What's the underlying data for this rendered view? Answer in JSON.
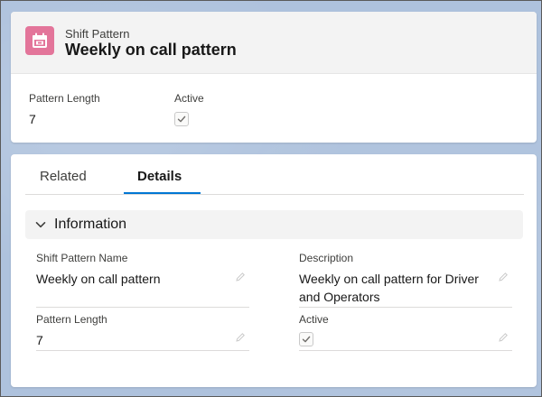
{
  "header": {
    "object_type": "Shift Pattern",
    "record_title": "Weekly on call pattern",
    "icon": "calendar-icon",
    "icon_color": "#e3759a",
    "highlights": [
      {
        "label": "Pattern Length",
        "value": "7"
      },
      {
        "label": "Active",
        "checked": true
      }
    ]
  },
  "tabs": [
    {
      "label": "Related",
      "active": false
    },
    {
      "label": "Details",
      "active": true
    }
  ],
  "accent_color": "#0176d3",
  "section": {
    "title": "Information",
    "expanded": true,
    "fields": {
      "shift_pattern_name": {
        "label": "Shift Pattern Name",
        "value": "Weekly on call pattern"
      },
      "description": {
        "label": "Description",
        "value": "Weekly on call pattern for Driver and Operators"
      },
      "pattern_length": {
        "label": "Pattern Length",
        "value": "7"
      },
      "active": {
        "label": "Active",
        "checked": true
      }
    }
  }
}
